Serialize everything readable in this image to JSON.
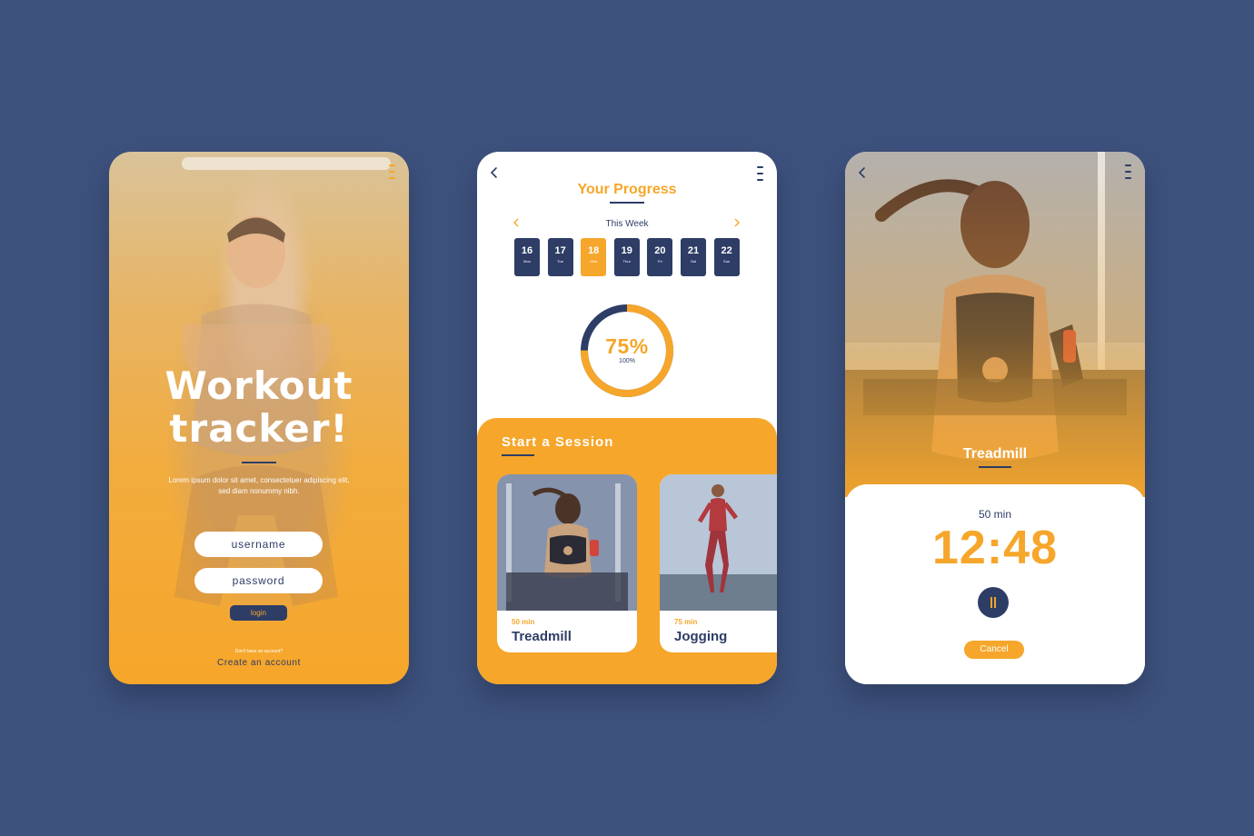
{
  "login": {
    "title_line1": "Workout",
    "title_line2": "tracker!",
    "description": "Lorem ipsum dolor sit amet, consectetuer adipiscing elit, sed diam nonummy nibh.",
    "username_placeholder": "username",
    "password_placeholder": "password",
    "login_label": "login",
    "no_account_text": "Don't have an account?",
    "create_account_label": "Create an account"
  },
  "progress": {
    "title": "Your Progress",
    "week_label": "This Week",
    "days": [
      {
        "num": "16",
        "day": "Mon",
        "active": false
      },
      {
        "num": "17",
        "day": "Tue",
        "active": false
      },
      {
        "num": "18",
        "day": "Wed",
        "active": true
      },
      {
        "num": "19",
        "day": "Thur",
        "active": false
      },
      {
        "num": "20",
        "day": "Fri",
        "active": false
      },
      {
        "num": "21",
        "day": "Sat",
        "active": false
      },
      {
        "num": "22",
        "day": "Sun",
        "active": false
      }
    ],
    "percent_label": "75%",
    "percent_value": 0.75,
    "total_label": "100%",
    "session_heading": "Start a Session",
    "sessions": [
      {
        "duration": "50 min",
        "name": "Treadmill"
      },
      {
        "duration": "75 min",
        "name": "Jogging"
      }
    ]
  },
  "timer": {
    "activity": "Treadmill",
    "duration": "50 min",
    "time": "12:48",
    "cancel_label": "Cancel"
  },
  "colors": {
    "background": "#3e527e",
    "accent": "#f6a62a",
    "navy": "#2e3d66",
    "white": "#ffffff"
  },
  "icons": [
    "back-arrow-icon",
    "menu-icon",
    "chevron-left-icon",
    "chevron-right-icon",
    "pause-icon"
  ]
}
